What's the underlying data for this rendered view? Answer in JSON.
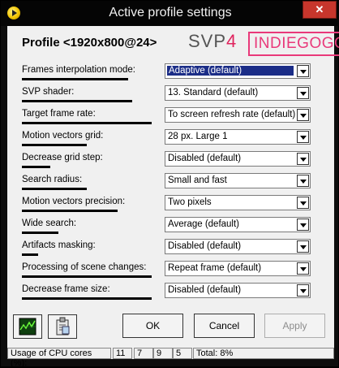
{
  "window": {
    "title": "Active profile settings",
    "close_glyph": "✕"
  },
  "profile": {
    "label": "Profile <1920x800@24>"
  },
  "brand": {
    "svp": "SVP",
    "svp_number": "4",
    "indiegogo": "INDIEGOGO"
  },
  "settings": [
    {
      "label": "Frames interpolation mode:",
      "value": "Adaptive (default)"
    },
    {
      "label": "SVP shader:",
      "value": "13. Standard (default)"
    },
    {
      "label": "Target frame rate:",
      "value": "To screen refresh rate (default)"
    },
    {
      "label": "Motion vectors grid:",
      "value": "28 px. Large 1"
    },
    {
      "label": "Decrease grid step:",
      "value": "Disabled (default)"
    },
    {
      "label": "Search radius:",
      "value": "Small and fast"
    },
    {
      "label": "Motion vectors precision:",
      "value": "Two pixels"
    },
    {
      "label": "Wide search:",
      "value": "Average (default)"
    },
    {
      "label": "Artifacts masking:",
      "value": "Disabled (default)"
    },
    {
      "label": "Processing of scene changes:",
      "value": "Repeat frame (default)"
    },
    {
      "label": "Decrease frame size:",
      "value": "Disabled (default)"
    }
  ],
  "buttons": {
    "ok": "OK",
    "cancel": "Cancel",
    "apply": "Apply"
  },
  "icons": {
    "graph": "graph-icon",
    "clipboard": "clipboard-icon"
  },
  "status": {
    "cpu_label": "Usage of CPU cores (%):",
    "cores": [
      "11",
      "7",
      "9",
      "5"
    ],
    "total": "Total: 8%"
  }
}
